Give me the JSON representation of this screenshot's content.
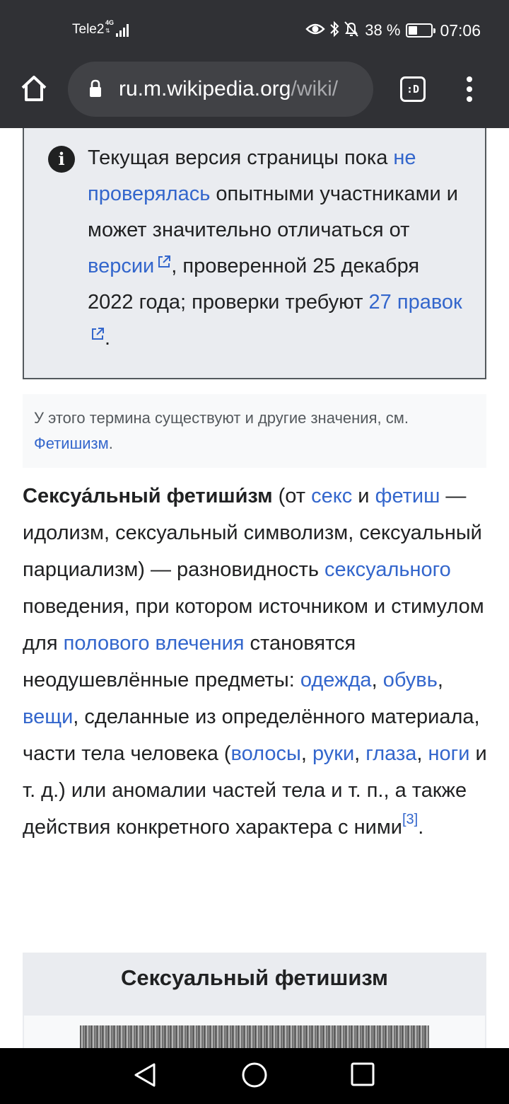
{
  "status_bar": {
    "carrier": "Tele2",
    "network": "4G",
    "battery": "38 %",
    "time": "07:06"
  },
  "browser": {
    "url_host": "ru.m.wikipedia.org",
    "url_path": "/wiki/",
    "tab_switcher_label": ":D"
  },
  "notice": {
    "t1": "Текущая версия страницы пока ",
    "link_not_checked": "не проверялась",
    "t2": " опытными участниками и может значительно отличаться от ",
    "link_version": "версии",
    "t3": ", проверенной 25 декабря 2022 года; проверки требуют ",
    "link_edits": "27 правок",
    "t4": "."
  },
  "hatnote": {
    "text": "У этого термина существуют и другие значения, см. ",
    "link": "Фетишизм",
    "end": "."
  },
  "article": {
    "title_bold": "Сексуа́льный фетиши́зм",
    "p1": " (от ",
    "link_sex": "секс",
    "p2": " и ",
    "link_fetish": "фетиш",
    "p3": " — идолизм, сексуальный символизм, сексуальный парциализм) — разновидность ",
    "link_sexual": "сексуального",
    "p4": " поведения, при котором источником и стимулом для ",
    "link_drive": "полового влечения",
    "p5": " становятся неодушевлённые предметы: ",
    "link_clothes": "одежда",
    "c1": ", ",
    "link_shoes": "обувь",
    "c2": ", ",
    "link_things": "вещи",
    "p6": ", сделанные из определённого материала, части тела человека (",
    "link_hair": "волосы",
    "c3": ", ",
    "link_hands": "руки",
    "c4": ", ",
    "link_eyes": "глаза",
    "c5": ", ",
    "link_legs": "ноги",
    "p7": " и т. д.) или аномалии частей тела и т. п., а также действия конкретного характера с ними",
    "ref": "[3]",
    "p8": "."
  },
  "infobox": {
    "title": "Сексуальный фетишизм"
  },
  "colors": {
    "link": "#3366cc",
    "chrome": "#303135",
    "notice_bg": "#eaecf0"
  }
}
